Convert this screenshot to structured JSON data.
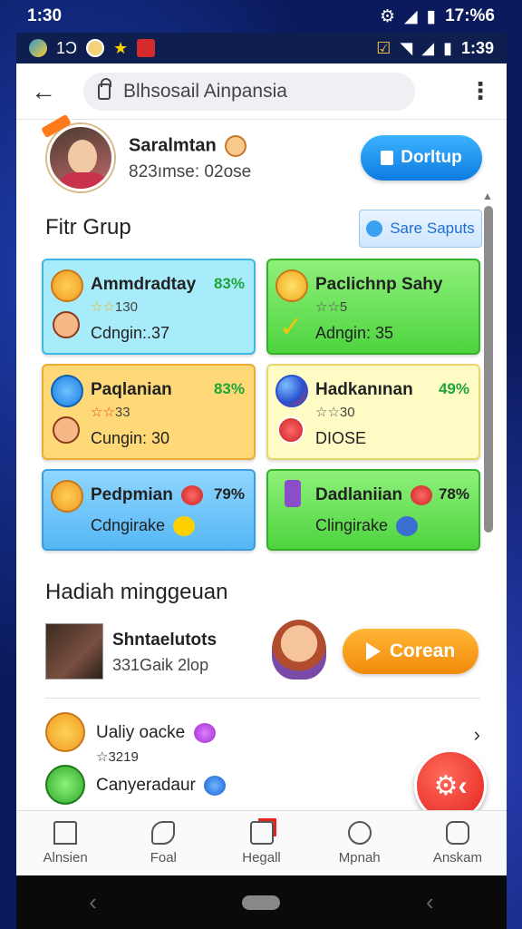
{
  "status_bar_top": {
    "time": "1:30",
    "right_time": "17:%6"
  },
  "status_bar_inner": {
    "left_text": "1Ɔ",
    "right_time": "1:39"
  },
  "browser": {
    "url": "Blhsosail Ainpansia"
  },
  "profile": {
    "name": "Saralmtan",
    "subtitle": "823ımse: 02ose",
    "button_label": "Dorltup"
  },
  "group": {
    "title": "Fitr Grup",
    "share_button": "Sare Saputs",
    "cards": [
      {
        "title": "Ammdradtay",
        "pct": "83%",
        "stars": "☆☆",
        "stars_num": "130",
        "sub": "Cdngin:.37",
        "theme": "blue",
        "icon": "gear-coin-icon"
      },
      {
        "title": "Paclichnp Sahy",
        "pct": "",
        "stars": "☆☆",
        "stars_num": "5",
        "sub": "Adngin: 35",
        "theme": "green",
        "icon": "trophy-coin-icon"
      },
      {
        "title": "Paqlanian",
        "pct": "83%",
        "stars": "☆☆",
        "stars_num": "33",
        "sub": "Cungin: 30",
        "theme": "yellow",
        "icon": "trash-badge-icon"
      },
      {
        "title": "Hadkanınan",
        "pct": "49%",
        "stars": "☆☆",
        "stars_num": "30",
        "sub": "DIOSE",
        "theme": "paleyellow",
        "icon": "berries-icon"
      },
      {
        "title": "Pedpmian",
        "pct": "79%",
        "stars": "",
        "stars_num": "",
        "sub": "Cdngirake",
        "theme": "sky",
        "icon": "gear-coin-icon"
      },
      {
        "title": "Dadlaniian",
        "pct": "78%",
        "stars": "",
        "stars_num": "",
        "sub": "Clingirake",
        "theme": "green",
        "icon": "potion-icon"
      }
    ]
  },
  "weekly": {
    "title": "Hadiah minggeuan",
    "item_title": "Shntaelutots",
    "item_sub": "331Gaik 2lop",
    "button_label": "Corean"
  },
  "list": [
    {
      "title": "Ualiy oacke",
      "sub": "☆3219"
    },
    {
      "title": "Canyeradaur",
      "sub": ""
    }
  ],
  "nav": [
    {
      "label": "Alnsien",
      "icon": "home-icon"
    },
    {
      "label": "Foal",
      "icon": "music-icon"
    },
    {
      "label": "Hegall",
      "icon": "edit-icon"
    },
    {
      "label": "Mpnah",
      "icon": "profile-icon"
    },
    {
      "label": "Anskam",
      "icon": "stack-icon"
    }
  ],
  "colors": {
    "accent_blue": "#0e7be0",
    "accent_orange": "#f28a0b",
    "fab_red": "#e32320",
    "pct_green": "#1ea43a"
  }
}
